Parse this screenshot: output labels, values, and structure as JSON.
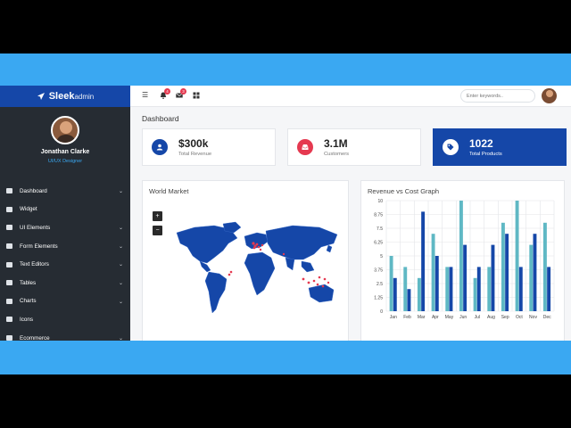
{
  "brand": {
    "name": "Sleek",
    "suffix": "admin"
  },
  "profile": {
    "name": "Jonathan Clarke",
    "role": "UI/UX Designer"
  },
  "sidebar": {
    "items": [
      {
        "label": "Dashboard",
        "icon": "dashboard-icon",
        "has_children": true
      },
      {
        "label": "Widget",
        "icon": "widget-icon",
        "has_children": false
      },
      {
        "label": "UI Elements",
        "icon": "ui-elements-icon",
        "has_children": true
      },
      {
        "label": "Form Elements",
        "icon": "form-icon",
        "has_children": true
      },
      {
        "label": "Text Editors",
        "icon": "editor-icon",
        "has_children": true
      },
      {
        "label": "Tables",
        "icon": "table-icon",
        "has_children": true
      },
      {
        "label": "Charts",
        "icon": "chart-icon",
        "has_children": true
      },
      {
        "label": "Icons",
        "icon": "icons-icon",
        "has_children": false
      },
      {
        "label": "Ecommerce",
        "icon": "cart-icon",
        "has_children": true
      }
    ]
  },
  "topbar": {
    "notification_count": "4",
    "message_count": "3",
    "search_placeholder": "Enter keywords.."
  },
  "page": {
    "title": "Dashboard"
  },
  "stats": [
    {
      "value": "$300k",
      "label": "Total Revenue",
      "color": "#1547a8"
    },
    {
      "value": "3.1M",
      "label": "Customers",
      "color": "#e53950"
    },
    {
      "value": "1022",
      "label": "Total Products",
      "color": "#1547a8"
    }
  ],
  "world_market": {
    "title": "World Market",
    "zoom_in": "+",
    "zoom_out": "−"
  },
  "colors": {
    "primary": "#1547a8",
    "teal": "#5fb8c4",
    "sidebar": "#262c33",
    "accent": "#3aa8f2",
    "marker": "#e53950"
  },
  "chart_data": {
    "type": "bar",
    "title": "Revenue vs Cost Graph",
    "categories": [
      "Jan",
      "Feb",
      "Mar",
      "Apr",
      "May",
      "Jun",
      "Jul",
      "Aug",
      "Sep",
      "Oct",
      "Nov",
      "Dec"
    ],
    "series": [
      {
        "values": [
          5,
          4,
          3,
          7,
          4,
          10,
          3,
          4,
          8,
          10,
          6,
          8
        ],
        "color": "#5fb8c4"
      },
      {
        "values": [
          3,
          2,
          9,
          5,
          4,
          6,
          4,
          6,
          7,
          4,
          7,
          4
        ],
        "color": "#1547a8"
      }
    ],
    "ylim": [
      0,
      10
    ],
    "yticks": [
      "0",
      "1.25",
      "2.5",
      "3.75",
      "5",
      "6.25",
      "7.5",
      "8.75",
      "10"
    ],
    "grid": true,
    "legend": "none"
  }
}
